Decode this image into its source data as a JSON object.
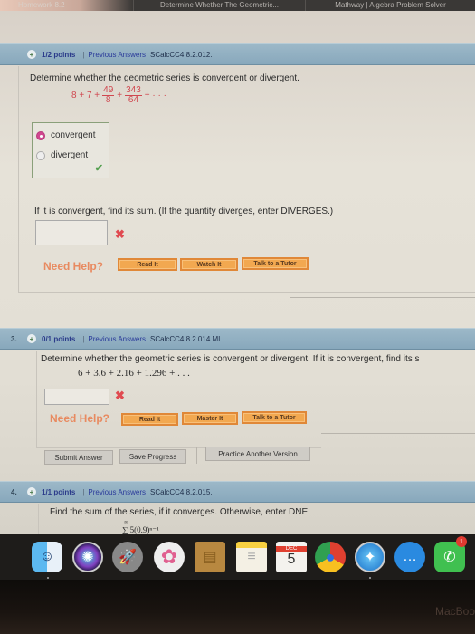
{
  "browser": {
    "tabs": [
      {
        "label": "Homework 8.2"
      },
      {
        "label": "Determine Whether The Geometric..."
      },
      {
        "label": "Mathway | Algebra Problem Solver"
      }
    ]
  },
  "questions": [
    {
      "number": "",
      "points": "1/2 points",
      "previous": "Previous Answers",
      "code": "SCalcCC4 8.2.012.",
      "prompt": "Determine whether the geometric series is convergent or divergent.",
      "series": {
        "t1": "8 + 7 +",
        "f1_num": "49",
        "f1_den": "8",
        "plus": "+",
        "f2_num": "343",
        "f2_den": "64",
        "tail": "+ · · ·"
      },
      "choices": [
        {
          "label": "convergent",
          "selected": true
        },
        {
          "label": "divergent",
          "selected": false
        }
      ],
      "choice_status": "✔",
      "sum_prompt": "If it is convergent, find its sum. (If the quantity diverges, enter DIVERGES.)",
      "answer_value": "",
      "answer_status": "✖",
      "help_label": "Need Help?",
      "help_buttons": [
        "Read It",
        "Watch It",
        "Talk to a Tutor"
      ]
    },
    {
      "number": "3.",
      "points": "0/1 points",
      "previous": "Previous Answers",
      "code": "SCalcCC4 8.2.014.MI.",
      "prompt": "Determine whether the geometric series is convergent or divergent. If it is convergent, find its s",
      "series": "6 + 3.6 + 2.16 + 1.296 + . . .",
      "answer_value": "",
      "answer_status": "✖",
      "help_label": "Need Help?",
      "help_buttons": [
        "Read It",
        "Master It",
        "Talk to a Tutor"
      ],
      "actions": [
        "Submit Answer",
        "Save Progress",
        "Practice Another Version"
      ]
    },
    {
      "number": "4.",
      "points": "1/1 points",
      "previous": "Previous Answers",
      "code": "SCalcCC4 8.2.015.",
      "prompt": "Find the sum of the series, if it converges. Otherwise, enter DNE.",
      "series": "∑ 5(0.9)ⁿ⁻¹",
      "series_top": "∞"
    }
  ],
  "dock": {
    "apps": [
      {
        "name": "Finder",
        "glyph": "☺"
      },
      {
        "name": "Siri",
        "glyph": "✺"
      },
      {
        "name": "Launchpad",
        "glyph": "🚀"
      },
      {
        "name": "Photos",
        "glyph": "✿"
      },
      {
        "name": "Contacts",
        "glyph": "▤"
      },
      {
        "name": "Notes",
        "glyph": "≡"
      },
      {
        "name": "Calendar",
        "month": "DEC",
        "day": "5"
      },
      {
        "name": "Chrome",
        "glyph": "●"
      },
      {
        "name": "Safari",
        "glyph": "✦"
      },
      {
        "name": "Messages",
        "glyph": "…"
      },
      {
        "name": "FaceTime",
        "glyph": "✆",
        "badge": "1"
      }
    ]
  },
  "bezel": {
    "brand": "MacBoo"
  },
  "colors": {
    "header_bar": "#8eacbf",
    "points_text": "#2a3a8a",
    "math_red": "#d04850",
    "radio_selected": "#d04890",
    "check_green": "#55a050",
    "x_red": "#e04a50",
    "help_orange": "#e88a60",
    "help_button": "#f2a850"
  }
}
